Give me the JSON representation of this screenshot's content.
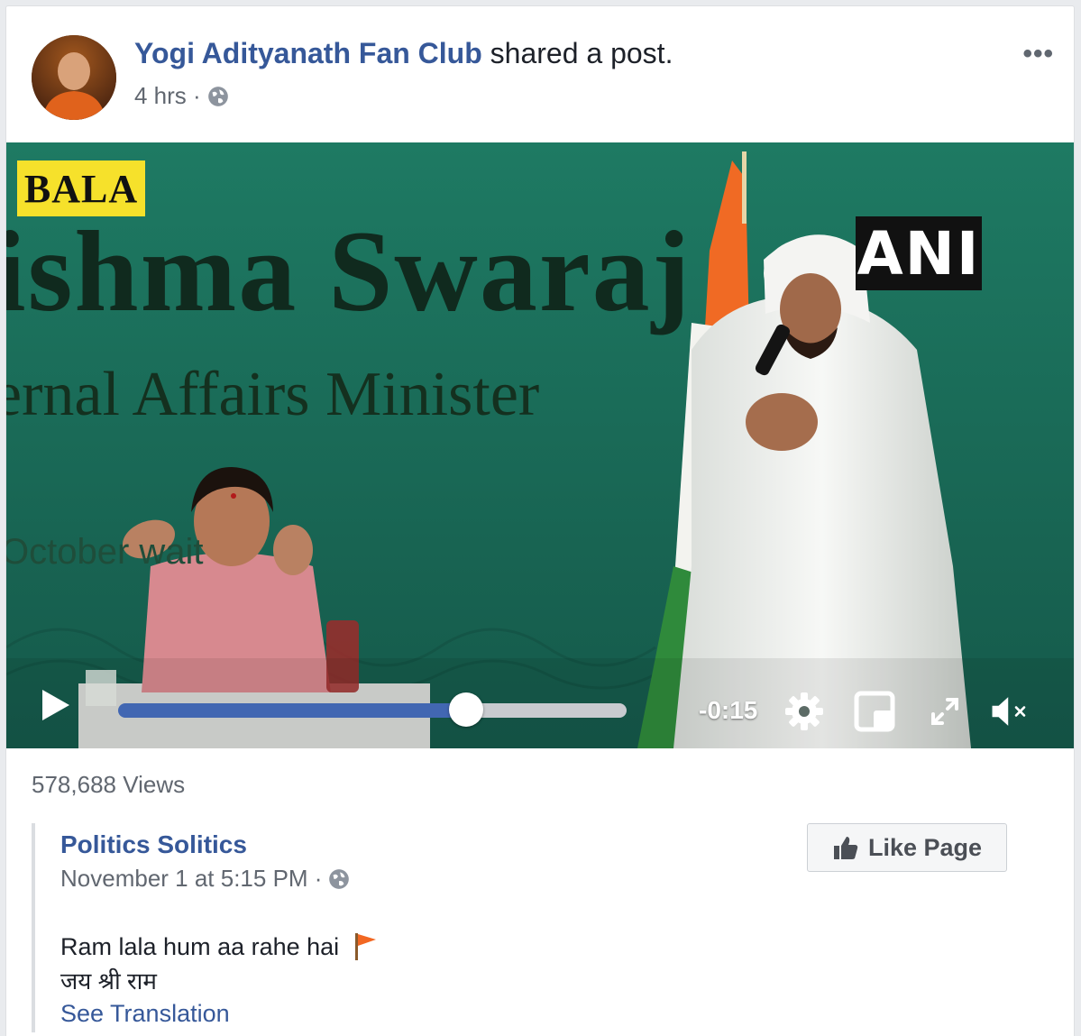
{
  "post": {
    "page_name": "Yogi Adityanath Fan Club",
    "action_text": " shared a post.",
    "time": "4 hrs ·",
    "menu_label": "•••",
    "views": "578,688 Views"
  },
  "video": {
    "corner_tag": "BALA",
    "banner_name": "ishma Swaraj",
    "banner_title": "ernal Affairs Minister",
    "banner_place": "October        wait",
    "agency_tag": "ANI",
    "time_remaining": "-0:15",
    "progress": 0.684,
    "muted": true
  },
  "shared_post": {
    "page_name": "Politics Solitics",
    "time": "November 1 at 5:15 PM ·",
    "like_button_label": "Like Page",
    "text_line1": "Ram lala hum aa rahe hai",
    "text_line2": "जय श्री राम",
    "see_translation": "See Translation"
  },
  "colors": {
    "link_blue": "#365899",
    "progress_blue": "#4267b2",
    "video_green": "#1b6b5a",
    "flag_orange": "#f26722"
  },
  "icons": {
    "audience": "globe-icon",
    "play": "play-icon",
    "settings": "gear-icon",
    "pip": "picture-in-picture-icon",
    "fullscreen": "expand-icon",
    "volume": "muted-speaker-icon",
    "like": "thumbs-up-icon",
    "emoji": "orange-flag-icon"
  }
}
